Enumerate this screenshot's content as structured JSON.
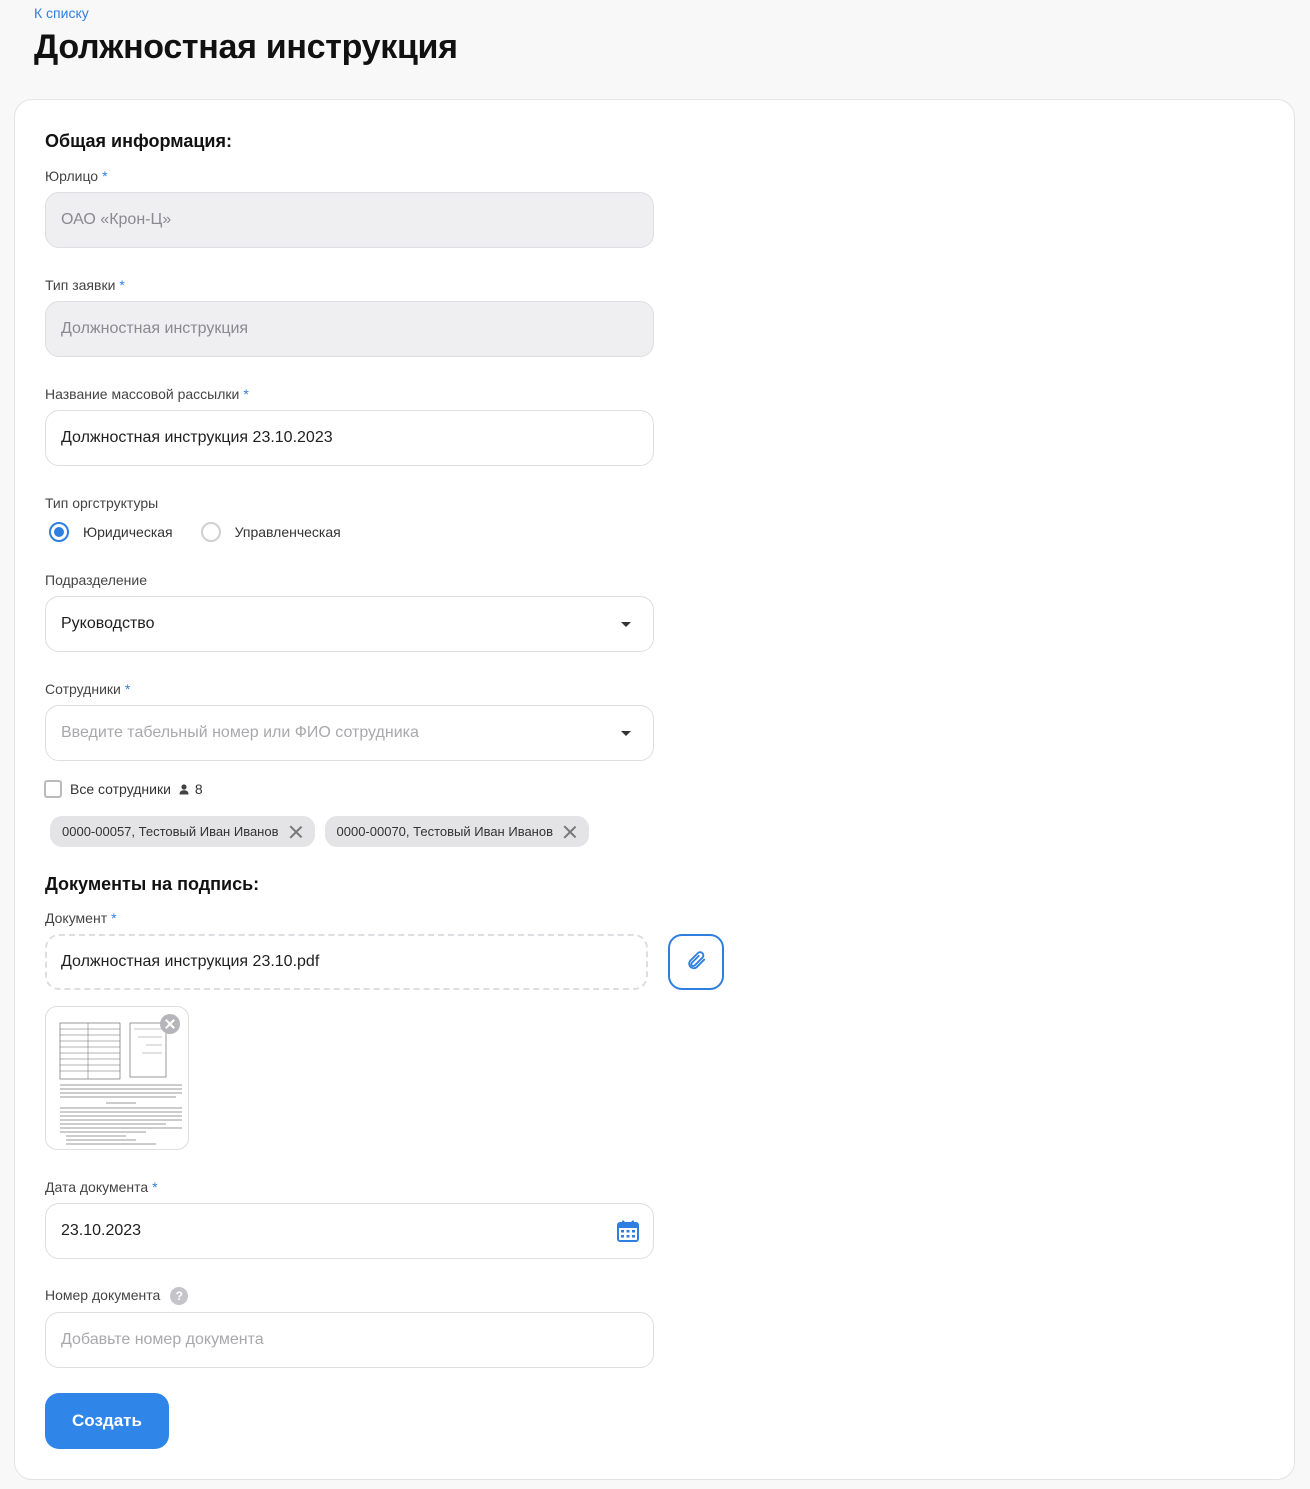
{
  "breadcrumb": {
    "back_label": "К списку"
  },
  "page": {
    "title": "Должностная инструкция"
  },
  "general": {
    "section_title": "Общая информация:",
    "legal_entity": {
      "label": "Юрлицо",
      "value": "ОАО «Крон-Ц»"
    },
    "request_type": {
      "label": "Тип заявки",
      "value": "Должностная инструкция"
    },
    "mailing_name": {
      "label": "Название массовой рассылки",
      "value": "Должностная инструкция 23.10.2023"
    },
    "org_structure": {
      "label": "Тип оргструктуры",
      "options": [
        "Юридическая",
        "Управленческая"
      ],
      "selected": "Юридическая"
    },
    "department": {
      "label": "Подразделение",
      "value": "Руководство"
    },
    "employees": {
      "label": "Сотрудники",
      "placeholder": "Введите табельный номер или ФИО сотрудника",
      "all_label": "Все сотрудники",
      "count": "8",
      "selected": [
        "0000-00057, Тестовый Иван Иванов",
        "0000-00070, Тестовый Иван Иванов"
      ]
    }
  },
  "documents": {
    "section_title": "Документы на подпись:",
    "document": {
      "label": "Документ",
      "file_name": "Должностная инструкция 23.10.pdf"
    },
    "date": {
      "label": "Дата документа",
      "value": "23.10.2023"
    },
    "number": {
      "label": "Номер документа",
      "placeholder": "Добавьте номер документа"
    }
  },
  "actions": {
    "create_label": "Создать"
  },
  "colors": {
    "accent": "#2f86e8",
    "required": "#2f7fe0"
  },
  "icons": [
    "caret-down-icon",
    "person-icon",
    "close-icon",
    "paperclip-icon",
    "calendar-icon",
    "help-icon"
  ]
}
